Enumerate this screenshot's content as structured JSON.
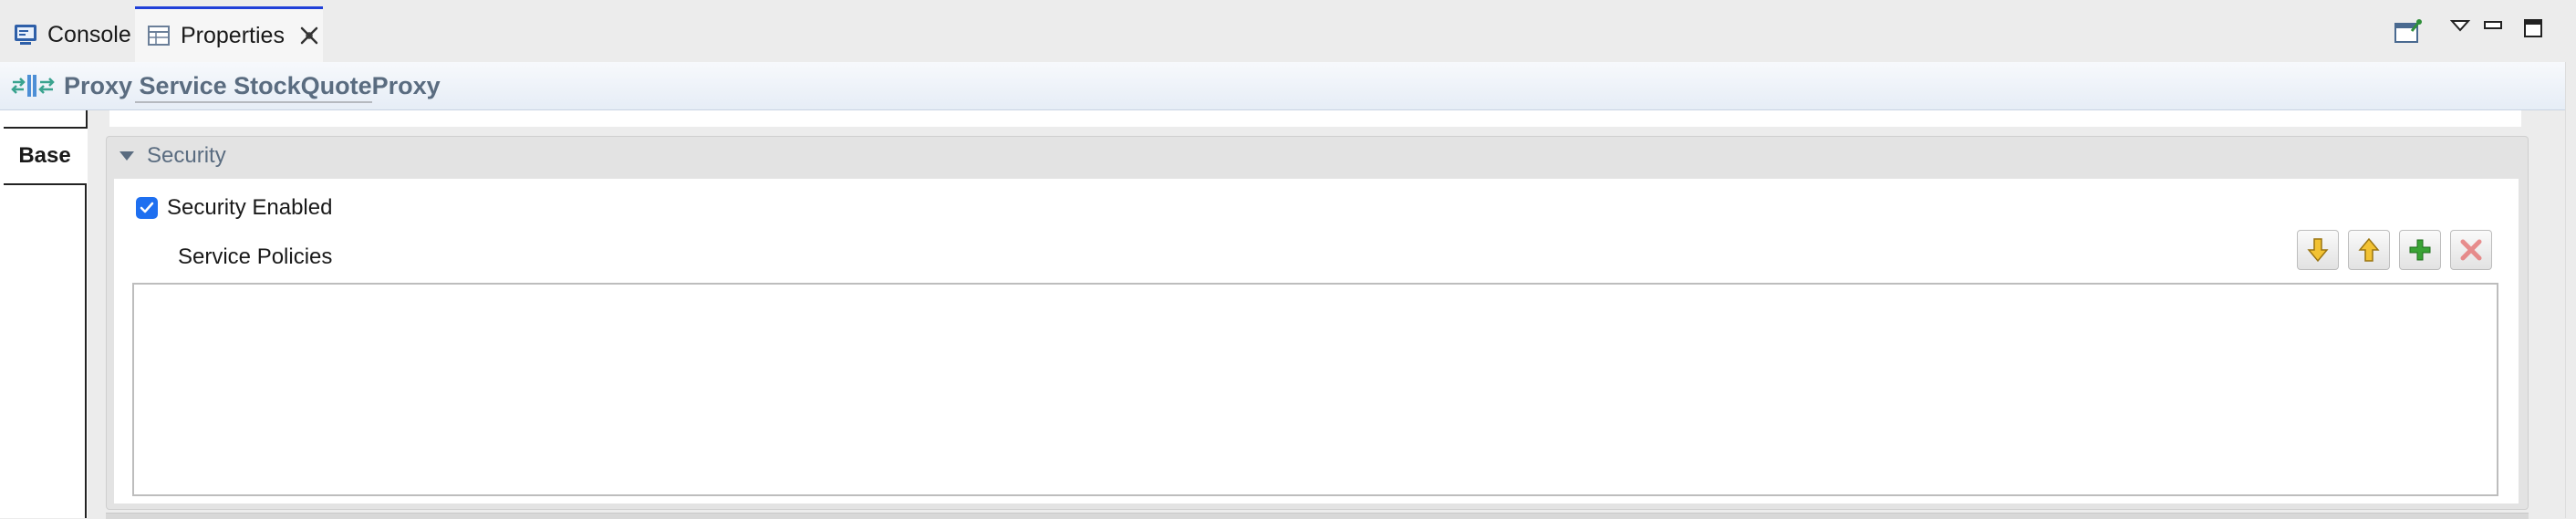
{
  "tabs": [
    {
      "label": "Console",
      "icon": "console-icon",
      "active": false
    },
    {
      "label": "Properties",
      "icon": "properties-table-icon",
      "active": true
    }
  ],
  "view_controls": [
    "open-editor-icon",
    "view-menu-icon",
    "minimize-icon",
    "maximize-icon"
  ],
  "title_bar": {
    "icon": "proxy-service-icon",
    "title": "Proxy Service StockQuoteProxy"
  },
  "left_tabs": [
    {
      "label": "Base",
      "selected": true
    }
  ],
  "section": {
    "title": "Security",
    "expanded": true,
    "security_enabled_label": "Security Enabled",
    "security_enabled_checked": true,
    "service_policies_label": "Service Policies",
    "toolbar": [
      "move-down-icon",
      "move-up-icon",
      "add-icon",
      "remove-icon"
    ],
    "policies": []
  },
  "colors": {
    "tab_accent": "#1f3fd8",
    "title_text": "#5a6c80",
    "checkbox": "#1e6ff0",
    "add_green": "#3aa335",
    "remove_red": "#e46b6b",
    "arrow_yellow": "#f2c233"
  }
}
